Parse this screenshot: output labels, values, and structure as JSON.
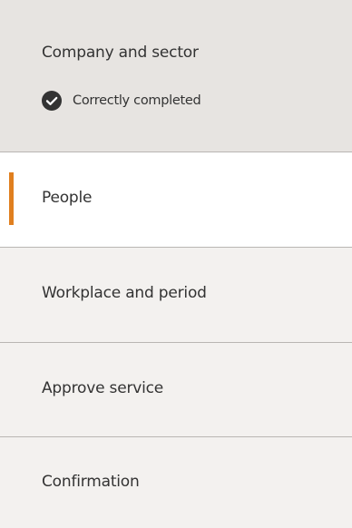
{
  "steps": [
    {
      "label": "Company and sector",
      "status": "Correctly completed",
      "state": "completed"
    },
    {
      "label": "People",
      "state": "active"
    },
    {
      "label": "Workplace and period",
      "state": "pending"
    },
    {
      "label": "Approve service",
      "state": "pending"
    },
    {
      "label": "Confirmation",
      "state": "pending"
    }
  ],
  "colors": {
    "completed_bg": "#e7e4e1",
    "active_bg": "#ffffff",
    "pending_bg": "#f3f1ef",
    "active_accent": "#e07f1f",
    "divider": "#b9b6b3",
    "text": "#333333"
  },
  "icons": {
    "completed": "check-circle-icon"
  }
}
